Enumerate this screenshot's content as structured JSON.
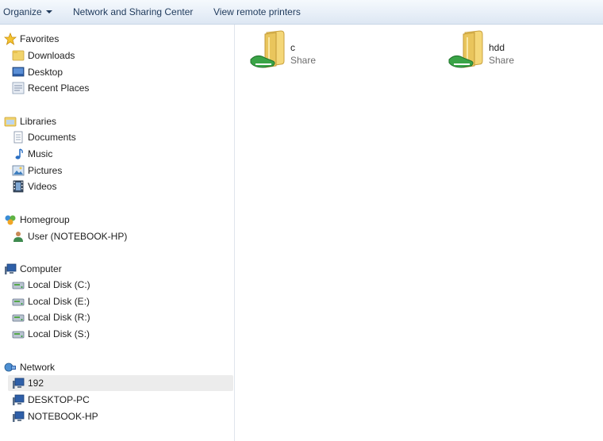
{
  "toolbar": {
    "organize": "Organize",
    "network_center": "Network and Sharing Center",
    "remote_printers": "View remote printers"
  },
  "nav": {
    "favorites": {
      "title": "Favorites",
      "items": [
        "Downloads",
        "Desktop",
        "Recent Places"
      ]
    },
    "libraries": {
      "title": "Libraries",
      "items": [
        "Documents",
        "Music",
        "Pictures",
        "Videos"
      ]
    },
    "homegroup": {
      "title": "Homegroup",
      "items": [
        "User (NOTEBOOK-HP)"
      ]
    },
    "computer": {
      "title": "Computer",
      "items": [
        "Local Disk (C:)",
        "Local Disk (E:)",
        "Local Disk (R:)",
        "Local Disk (S:)"
      ]
    },
    "network": {
      "title": "Network",
      "items": [
        "192",
        "DESKTOP-PC",
        "NOTEBOOK-HP"
      ],
      "selected": "192"
    }
  },
  "shares": [
    {
      "name": "c",
      "type": "Share"
    },
    {
      "name": "hdd",
      "type": "Share"
    }
  ]
}
